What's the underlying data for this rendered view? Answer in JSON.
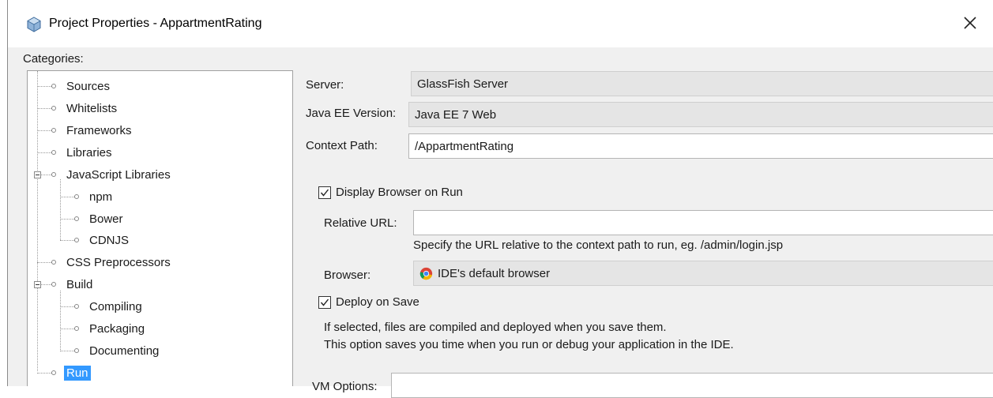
{
  "window": {
    "title": "Project Properties - AppartmentRating",
    "close_symbol": "×"
  },
  "categories_label": "Categories:",
  "tree": {
    "items": [
      {
        "label": "Sources",
        "level": 1
      },
      {
        "label": "Whitelists",
        "level": 1
      },
      {
        "label": "Frameworks",
        "level": 1
      },
      {
        "label": "Libraries",
        "level": 1
      },
      {
        "label": "JavaScript Libraries",
        "level": 1,
        "expanded": true
      },
      {
        "label": "npm",
        "level": 2
      },
      {
        "label": "Bower",
        "level": 2
      },
      {
        "label": "CDNJS",
        "level": 2
      },
      {
        "label": "CSS Preprocessors",
        "level": 1
      },
      {
        "label": "Build",
        "level": 1,
        "expanded": true
      },
      {
        "label": "Compiling",
        "level": 2
      },
      {
        "label": "Packaging",
        "level": 2
      },
      {
        "label": "Documenting",
        "level": 2
      },
      {
        "label": "Run",
        "level": 1,
        "selected": true
      }
    ]
  },
  "run": {
    "server_label": "Server:",
    "server_value": "GlassFish Server",
    "javaee_label": "Java EE Version:",
    "javaee_value": "Java EE 7 Web",
    "context_label": "Context Path:",
    "context_value": "/AppartmentRating",
    "display_browser_label": "Display Browser on Run",
    "display_browser_checked": true,
    "relative_url_label": "Relative URL:",
    "relative_url_value": "",
    "relative_url_hint": "Specify the URL relative to the context path to run, eg. /admin/login.jsp",
    "browser_label": "Browser:",
    "browser_value": "IDE's default browser",
    "browser_icon": "chrome-icon",
    "deploy_label": "Deploy on Save",
    "deploy_checked": true,
    "deploy_hint_1": "If selected, files are compiled and deployed when you save them.",
    "deploy_hint_2": "This option saves you time when you run or debug your application in the IDE.",
    "vm_options_label": "VM Options:"
  },
  "colors": {
    "selection": "#3399ff",
    "dialog_bg": "#f0f0f0",
    "readonly_field": "#e5e5e5"
  }
}
